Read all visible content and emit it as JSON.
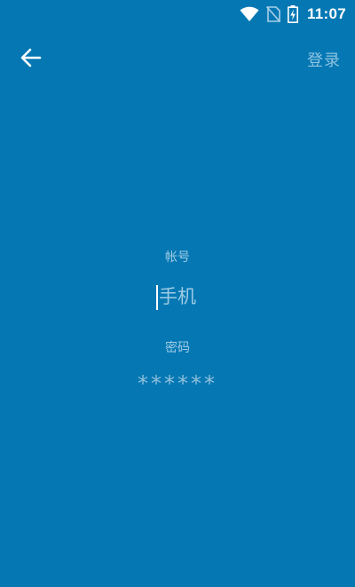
{
  "status_bar": {
    "time": "11:07",
    "icons": [
      "wifi-icon",
      "no-sim-icon",
      "battery-charging-icon"
    ]
  },
  "toolbar": {
    "back_icon": "arrow-left-icon",
    "login_label": "登录"
  },
  "form": {
    "account_label": "帐号",
    "account_placeholder": "手机",
    "password_label": "密码",
    "password_placeholder": "******"
  },
  "colors": {
    "background": "#0578b4",
    "text_primary": "#ffffff",
    "text_muted": "#9fcbe4"
  }
}
